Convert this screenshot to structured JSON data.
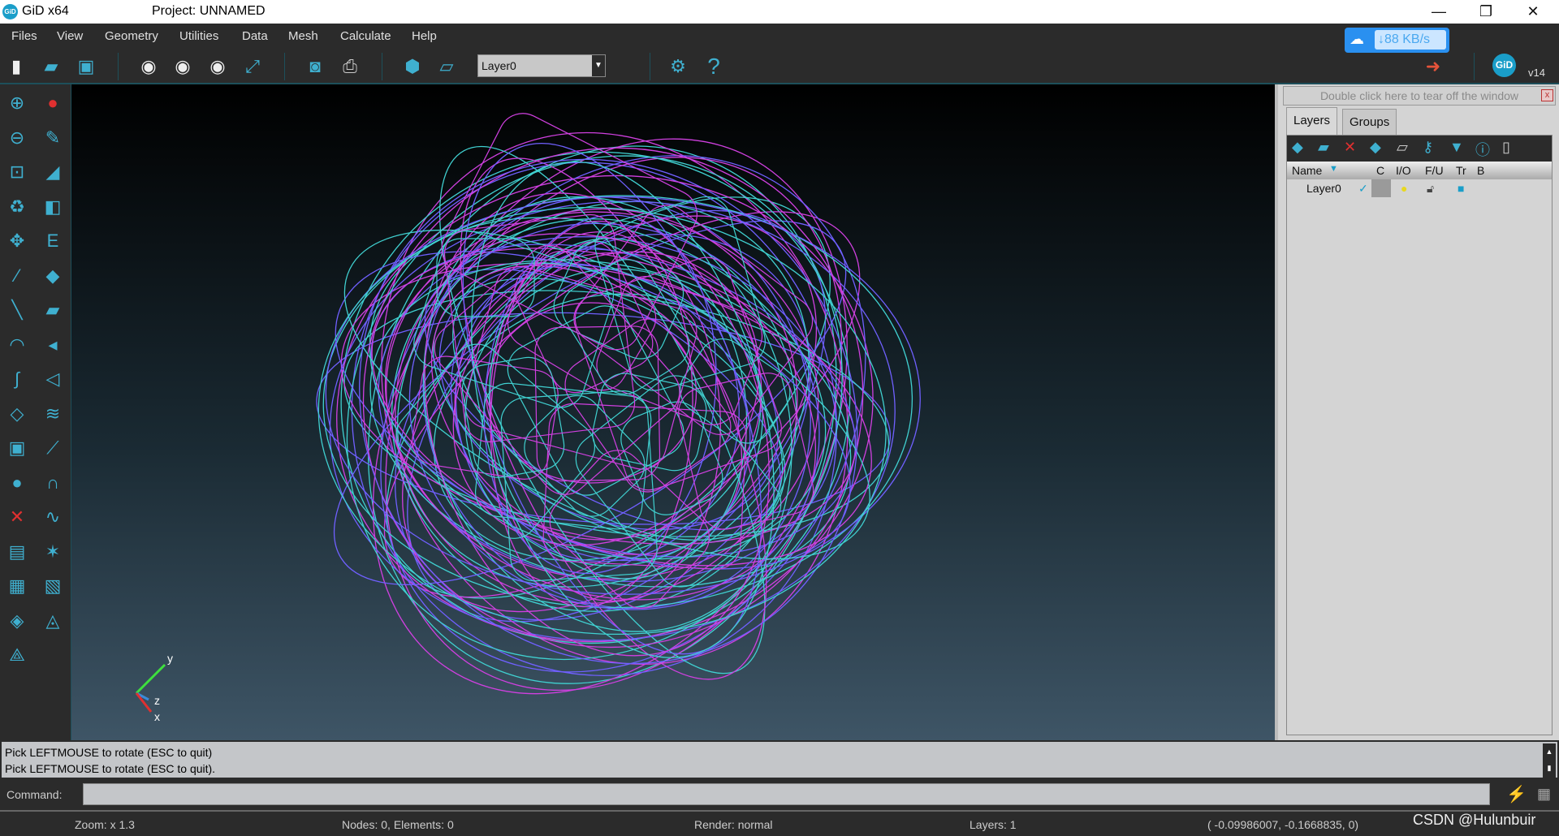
{
  "window": {
    "app_title": "GiD x64",
    "project_title": "Project: UNNAMED",
    "minimize": "—",
    "restore": "❐",
    "close": "✕"
  },
  "menu": [
    "Files",
    "View",
    "Geometry",
    "Utilities",
    "Data",
    "Mesh",
    "Calculate",
    "Help"
  ],
  "toolbar": {
    "layer_select": "Layer0",
    "dropdown": "▼"
  },
  "network_badge": {
    "speed": "↓88 KB/s",
    "icon": "cloud-icon"
  },
  "logo": {
    "text": "GiD",
    "version": "v14"
  },
  "right_panel": {
    "tear_off": "Double click here to tear off the window",
    "tear_close": "x",
    "tabs": [
      "Layers",
      "Groups"
    ],
    "columns": [
      "Name",
      "C",
      "I/O",
      "F/U",
      "Tr",
      "B"
    ],
    "rows": [
      {
        "name": "Layer0",
        "check": "✓"
      }
    ]
  },
  "messages": [
    "Pick LEFTMOUSE to rotate (ESC to quit)",
    "Pick LEFTMOUSE to rotate (ESC to quit)."
  ],
  "command": {
    "label": "Command:",
    "value": ""
  },
  "status": {
    "zoom": "Zoom: x 1.3",
    "nodes": "Nodes: 0, Elements: 0",
    "render": "Render: normal",
    "layers": "Layers: 1",
    "coords": "( -0.09986007, -0.1668835,  0)"
  },
  "axes": {
    "y": "y",
    "z": "z",
    "x": "x"
  },
  "watermark": "CSDN @Hulunbuir",
  "colors": {
    "accent": "#3fb0d0",
    "curve_magenta": "#d040e0",
    "curve_cyan": "#40d0d0",
    "curve_blue": "#7060ff"
  }
}
